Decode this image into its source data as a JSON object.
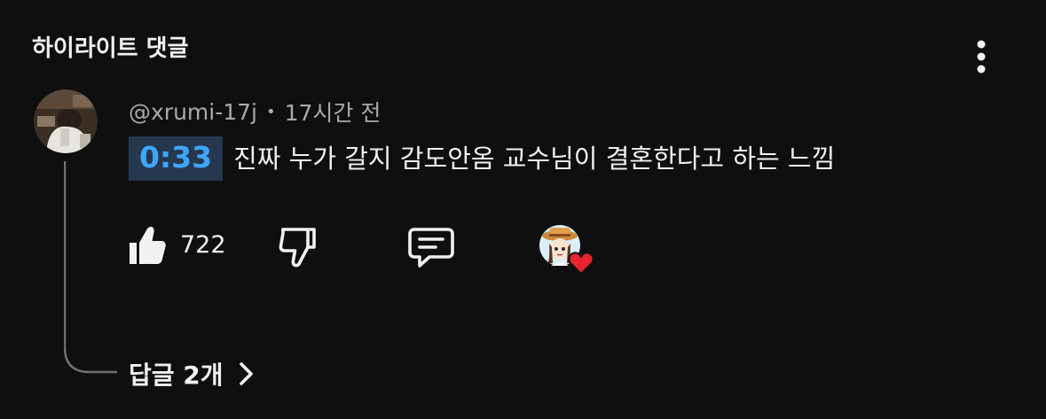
{
  "section": {
    "title": "하이라이트 댓글"
  },
  "comment": {
    "author": "@xrumi-17j",
    "separator": "•",
    "time": "17시간 전",
    "timestamp": "0:33",
    "text": "진짜 누가 갈지 감도안옴 교수님이 결혼한다고 하는 느낌",
    "like_count": "722",
    "replies_label": "답글 2개"
  },
  "icons": {
    "more": "more-vert-icon",
    "like": "thumbs-up-icon",
    "dislike": "thumbs-down-icon",
    "reply": "comment-bubble-icon",
    "heart": "creator-heart-icon",
    "chevron": "chevron-right-icon"
  },
  "colors": {
    "background": "#0f0f0f",
    "text": "#f1f1f1",
    "secondary_text": "#aaaaaa",
    "timestamp_link": "#3ea6ff",
    "timestamp_bg": "#263850",
    "heart": "#e8242c"
  }
}
